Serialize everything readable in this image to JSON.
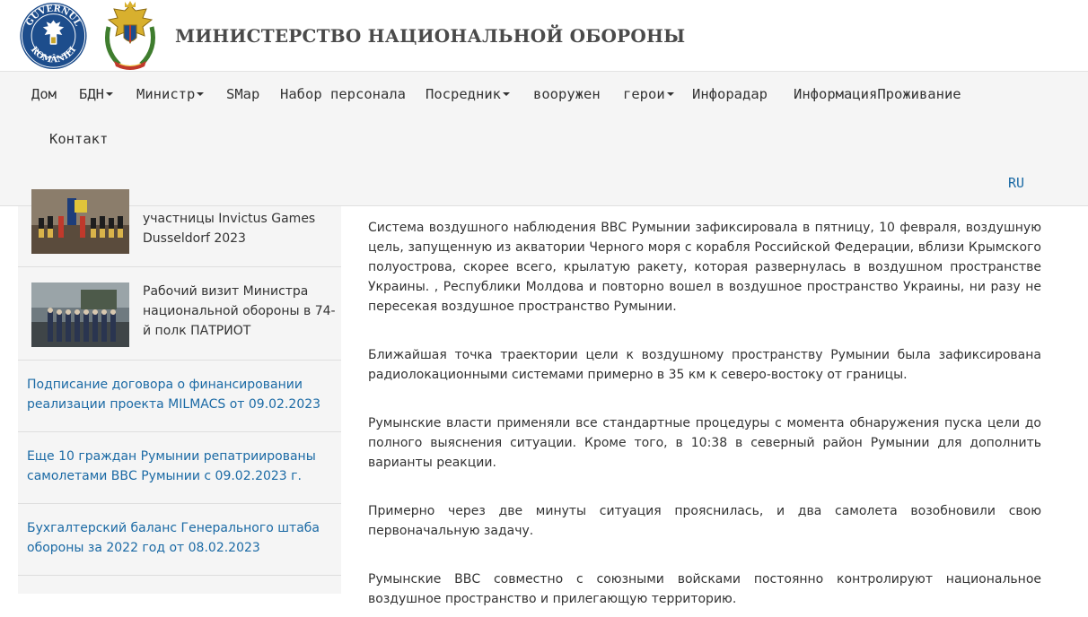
{
  "header": {
    "title": "МИНИСТЕРСТВО НАЦИОНАЛЬНОЙ ОБОРОНЫ",
    "gov_logo_text_top": "GUVERNUL",
    "gov_logo_text_bottom": "ROMÂNIEI"
  },
  "nav": {
    "items": [
      {
        "label": "Дом",
        "dropdown": false
      },
      {
        "label": "БДН",
        "dropdown": true
      },
      {
        "label": "Министр",
        "dropdown": true
      },
      {
        "label": "SMap",
        "dropdown": false
      },
      {
        "label": "Набор персонала",
        "dropdown": false
      },
      {
        "label": "Посредник",
        "dropdown": true
      },
      {
        "label": "вооружен",
        "dropdown": false
      },
      {
        "label": "герои",
        "dropdown": true
      },
      {
        "label": "Инфорадар",
        "dropdown": false
      },
      {
        "label": "ИнформацияПроживание",
        "dropdown": false
      },
      {
        "label": "Контакт",
        "dropdown": false
      }
    ],
    "lang": "RU"
  },
  "sidebar": {
    "news_with_image": [
      {
        "title": "участницы Invictus Games Dusseldorf 2023"
      },
      {
        "title": "Рабочий визит Министра национальной обороны в 74-й полк ПАТРИОТ"
      }
    ],
    "news_links": [
      {
        "title": "Подписание договора о финансировании реализации проекта MILMACS от 09.02.2023"
      },
      {
        "title": "Еще 10 граждан Румынии репатриированы самолетами ВВС Румынии с 09.02.2023 г."
      },
      {
        "title": "Бухгалтерский баланс Генерального штаба обороны за 2022 год от 08.02.2023"
      }
    ]
  },
  "article": {
    "paragraphs": [
      "Система воздушного наблюдения ВВС Румынии зафиксировала в пятницу, 10 февраля, воздушную цель, запущенную из акватории Черного моря с корабля Российской Федерации, вблизи Крымского полуострова, скорее всего, крылатую ракету, которая развернулась в воздушном пространстве Украины. , Республики Молдова и повторно вошел в воздушное пространство Украины, ни разу не пересекая воздушное пространство Румынии.",
      "Ближайшая точка траектории цели к воздушному пространству Румынии была зафиксирована радиолокационными системами примерно в 35 км к северо-востоку от границы.",
      "Румынские власти применяли все стандартные процедуры с момента обнаружения пуска цели до полного выяснения ситуации. Кроме того, в 10:38 в северный район Румынии для дополнить варианты реакции.",
      "Примерно через две минуты ситуация прояснилась, и два самолета возобновили свою первоначальную задачу.",
      "Румынские ВВС совместно с союзными войсками постоянно контролируют национальное воздушное пространство и прилегающую территорию."
    ]
  },
  "colors": {
    "link": "#1b6aa5",
    "nav_bg": "#f5f5f5",
    "gov_blue": "#1d4d8c",
    "title_gray": "#4a4a4a"
  }
}
